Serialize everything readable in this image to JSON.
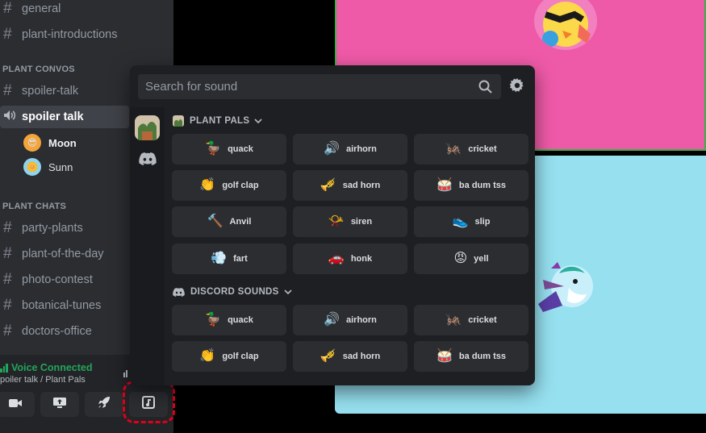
{
  "sidebar": {
    "channels_top": [
      {
        "label": "general"
      },
      {
        "label": "plant-introductions"
      }
    ],
    "category_convos": "PLANT CONVOS",
    "spoiler_talk_text": "spoiler-talk",
    "voice_channel": "spoiler talk",
    "users": [
      {
        "name": "Moon"
      },
      {
        "name": "Sunn"
      }
    ],
    "category_chats": "PLANT CHATS",
    "channels_chats": [
      {
        "label": "party-plants"
      },
      {
        "label": "plant-of-the-day"
      },
      {
        "label": "photo-contest"
      },
      {
        "label": "botanical-tunes"
      },
      {
        "label": "doctors-office"
      }
    ]
  },
  "voice_panel": {
    "status": "Voice Connected",
    "location": "poiler talk / Plant Pals",
    "status_color": "#23a55a"
  },
  "soundboard": {
    "search_placeholder": "Search for sound",
    "sections": [
      {
        "title": "PLANT PALS",
        "sounds": [
          {
            "label": "quack",
            "emoji": "🦆"
          },
          {
            "label": "airhorn",
            "emoji": "🔊"
          },
          {
            "label": "cricket",
            "emoji": "🦗"
          },
          {
            "label": "golf clap",
            "emoji": "👏"
          },
          {
            "label": "sad horn",
            "emoji": "🎺"
          },
          {
            "label": "ba dum tss",
            "emoji": "🥁"
          },
          {
            "label": "Anvil",
            "emoji": "🔨"
          },
          {
            "label": "siren",
            "emoji": "📯"
          },
          {
            "label": "slip",
            "emoji": "👟"
          },
          {
            "label": "fart",
            "emoji": "💨"
          },
          {
            "label": "honk",
            "emoji": "🚗"
          },
          {
            "label": "yell",
            "emoji": "😡"
          }
        ]
      },
      {
        "title": "DISCORD SOUNDS",
        "sounds": [
          {
            "label": "quack",
            "emoji": "🦆"
          },
          {
            "label": "airhorn",
            "emoji": "🔊"
          },
          {
            "label": "cricket",
            "emoji": "🦗"
          },
          {
            "label": "golf clap",
            "emoji": "👏"
          },
          {
            "label": "sad horn",
            "emoji": "🎺"
          },
          {
            "label": "ba dum tss",
            "emoji": "🥁"
          }
        ]
      }
    ]
  },
  "colors": {
    "sidebar_bg": "#2b2d31",
    "popup_bg": "#1e1f22",
    "button_bg": "#2b2d31",
    "pink_tile": "#ef5aa8",
    "blue_tile": "#96e0f0",
    "highlight": "#e0001a"
  }
}
